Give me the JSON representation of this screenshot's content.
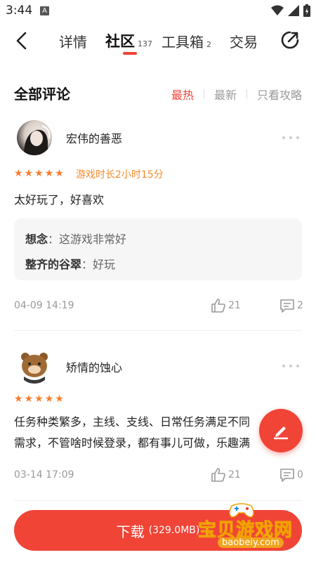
{
  "status_bar": {
    "time": "3:44",
    "notification_badge": "A"
  },
  "nav": {
    "tabs": [
      {
        "label": "详情",
        "count": ""
      },
      {
        "label": "社区",
        "count": "137"
      },
      {
        "label": "工具箱",
        "count": "2"
      },
      {
        "label": "交易",
        "count": ""
      }
    ],
    "active_tab": "社区"
  },
  "section": {
    "title": "全部评论",
    "sort_options": [
      "最热",
      "最新",
      "只看攻略"
    ],
    "active_sort": "最热"
  },
  "comments": [
    {
      "username": "宏伟的善恶",
      "rating": 5,
      "playtime": "游戏时长2小时15分",
      "text": "太好玩了，好喜欢",
      "replies": [
        {
          "user": "想念",
          "text": "：这游戏非常好"
        },
        {
          "user": "整齐的谷翠",
          "text": "：好玩"
        }
      ],
      "date": "04-09 14:19",
      "likes": "21",
      "reply_count": "2"
    },
    {
      "username": "矫情的蚀心",
      "rating": 5,
      "playtime": "",
      "text_line1": "任务种类繁多，主线、支线、日常任务满足不同",
      "text_line2": "需求，不管啥时候登录，都有事儿可做，乐趣满",
      "date": "03-14 17:09",
      "likes": "21",
      "reply_count": "0"
    }
  ],
  "download": {
    "label": "下载",
    "size": "(329.0MB)"
  },
  "watermark": {
    "text": "宝贝游戏网",
    "url": "baobeiy.com"
  },
  "colors": {
    "accent": "#f04437",
    "star": "#fa7c2a",
    "playtime": "#f58a2d"
  }
}
